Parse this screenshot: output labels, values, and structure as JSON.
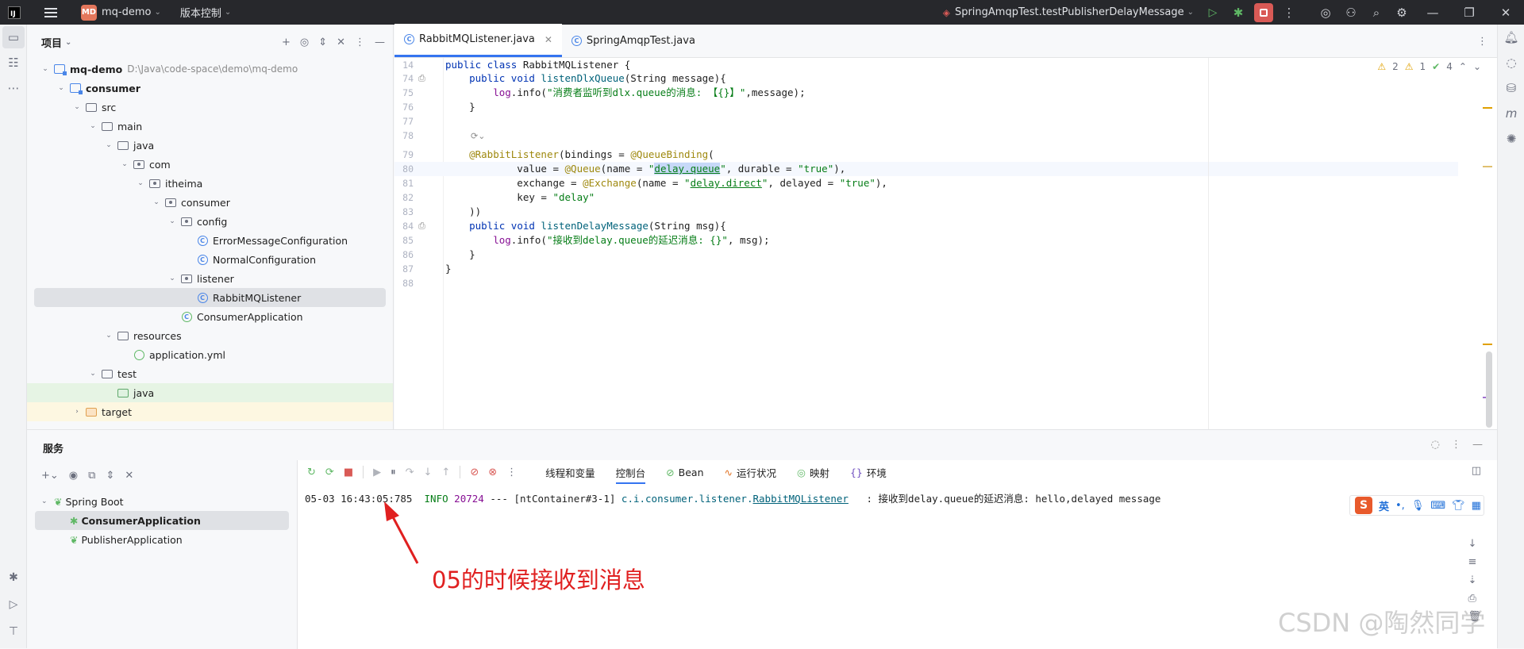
{
  "titlebar": {
    "project_badge": "MD",
    "project_name": "mq-demo",
    "vcs_menu": "版本控制",
    "run_config": "SpringAmqpTest.testPublisherDelayMessage"
  },
  "project_panel": {
    "title": "项目",
    "tree": [
      {
        "label": "mq-demo",
        "path": "D:\\Java\\code-space\\demo\\mq-demo",
        "depth": 0,
        "kind": "module",
        "expanded": true,
        "bold": true
      },
      {
        "label": "consumer",
        "depth": 1,
        "kind": "module",
        "expanded": true,
        "bold": true
      },
      {
        "label": "src",
        "depth": 2,
        "kind": "folder",
        "expanded": true
      },
      {
        "label": "main",
        "depth": 3,
        "kind": "folder",
        "expanded": true
      },
      {
        "label": "java",
        "depth": 4,
        "kind": "folder",
        "expanded": true
      },
      {
        "label": "com",
        "depth": 5,
        "kind": "package",
        "expanded": true
      },
      {
        "label": "itheima",
        "depth": 6,
        "kind": "package",
        "expanded": true
      },
      {
        "label": "consumer",
        "depth": 7,
        "kind": "package",
        "expanded": true
      },
      {
        "label": "config",
        "depth": 8,
        "kind": "package",
        "expanded": true
      },
      {
        "label": "ErrorMessageConfiguration",
        "depth": 9,
        "kind": "class"
      },
      {
        "label": "NormalConfiguration",
        "depth": 9,
        "kind": "class"
      },
      {
        "label": "listener",
        "depth": 8,
        "kind": "package",
        "expanded": true
      },
      {
        "label": "RabbitMQListener",
        "depth": 9,
        "kind": "class",
        "selected": true
      },
      {
        "label": "ConsumerApplication",
        "depth": 8,
        "kind": "springclass"
      },
      {
        "label": "resources",
        "depth": 4,
        "kind": "resfolder",
        "expanded": true
      },
      {
        "label": "application.yml",
        "depth": 5,
        "kind": "yml"
      },
      {
        "label": "test",
        "depth": 3,
        "kind": "folder",
        "expanded": true
      },
      {
        "label": "java",
        "depth": 4,
        "kind": "testfolder",
        "highlight": "green"
      },
      {
        "label": "target",
        "depth": 2,
        "kind": "target",
        "expanded": false,
        "highlight": "yellow"
      }
    ]
  },
  "editor": {
    "tabs": [
      {
        "label": "RabbitMQListener.java",
        "active": true,
        "closable": true
      },
      {
        "label": "SpringAmqpTest.java",
        "active": false,
        "closable": false
      }
    ],
    "inspections": {
      "warnings": "2",
      "weak_warnings": "1",
      "ok": "4"
    },
    "lines": [
      {
        "n": "14",
        "tokens": [
          [
            "kw",
            "public class "
          ],
          [
            "",
            "RabbitMQListener {"
          ]
        ]
      },
      {
        "n": "74",
        "gutter": "run",
        "tokens": [
          [
            "",
            "    "
          ],
          [
            "kw",
            "public void "
          ],
          [
            "fn",
            "listenDlxQueue"
          ],
          [
            "",
            "(String message){"
          ]
        ]
      },
      {
        "n": "75",
        "tokens": [
          [
            "",
            "        "
          ],
          [
            "fld",
            "log"
          ],
          [
            "",
            ".info("
          ],
          [
            "str",
            "\"消费者监听到dlx.queue的消息: 【{}】\""
          ],
          [
            "",
            ",message);"
          ]
        ]
      },
      {
        "n": "76",
        "tokens": [
          [
            "",
            "    }"
          ]
        ]
      },
      {
        "n": "77",
        "tokens": []
      },
      {
        "n": "78",
        "tokens": [],
        "inlay": "⟳⌄"
      },
      {
        "n": "79",
        "tokens": [
          [
            "",
            "    "
          ],
          [
            "ann",
            "@RabbitListener"
          ],
          [
            "",
            "(bindings = "
          ],
          [
            "ann",
            "@QueueBinding"
          ],
          [
            "",
            "("
          ]
        ]
      },
      {
        "n": "80",
        "current": true,
        "tokens": [
          [
            "",
            "            value = "
          ],
          [
            "ann",
            "@Queue"
          ],
          [
            "",
            "(name = "
          ],
          [
            "str",
            "\""
          ],
          [
            "str hl link",
            "delay.queue"
          ],
          [
            "str",
            "\""
          ],
          [
            "",
            ", durable = "
          ],
          [
            "str",
            "\"true\""
          ],
          [
            "",
            "),"
          ]
        ]
      },
      {
        "n": "81",
        "tokens": [
          [
            "",
            "            exchange = "
          ],
          [
            "ann",
            "@Exchange"
          ],
          [
            "",
            "(name = "
          ],
          [
            "str",
            "\""
          ],
          [
            "str link",
            "delay.direct"
          ],
          [
            "str",
            "\""
          ],
          [
            "",
            ", delayed = "
          ],
          [
            "str",
            "\"true\""
          ],
          [
            "",
            "),"
          ]
        ]
      },
      {
        "n": "82",
        "tokens": [
          [
            "",
            "            key = "
          ],
          [
            "str",
            "\"delay\""
          ]
        ]
      },
      {
        "n": "83",
        "tokens": [
          [
            "",
            "    ))"
          ]
        ]
      },
      {
        "n": "84",
        "gutter": "run",
        "tokens": [
          [
            "",
            "    "
          ],
          [
            "kw",
            "public void "
          ],
          [
            "fn",
            "listenDelayMessage"
          ],
          [
            "",
            "(String msg){"
          ]
        ]
      },
      {
        "n": "85",
        "tokens": [
          [
            "",
            "        "
          ],
          [
            "fld",
            "log"
          ],
          [
            "",
            ".info("
          ],
          [
            "str",
            "\"接收到delay.queue的延迟消息: {}\""
          ],
          [
            "",
            ", msg);"
          ]
        ]
      },
      {
        "n": "86",
        "tokens": [
          [
            "",
            "    }"
          ]
        ]
      },
      {
        "n": "87",
        "tokens": [
          [
            "",
            "}"
          ]
        ]
      },
      {
        "n": "88",
        "tokens": []
      }
    ]
  },
  "services": {
    "title": "服务",
    "tree": [
      {
        "label": "Spring Boot",
        "depth": 0,
        "expanded": true
      },
      {
        "label": "ConsumerApplication",
        "depth": 1,
        "selected": true,
        "bold": true
      },
      {
        "label": "PublisherApplication",
        "depth": 1
      }
    ],
    "console_tabs": [
      {
        "label": "线程和变量",
        "active": false
      },
      {
        "label": "控制台",
        "active": true
      },
      {
        "label": "Bean",
        "active": false
      },
      {
        "label": "运行状况",
        "active": false
      },
      {
        "label": "映射",
        "active": false
      },
      {
        "label": "环境",
        "active": false
      }
    ],
    "log": {
      "timestamp": "05-03 16:43:05:785",
      "level": "INFO",
      "pid": "20724",
      "sep": "---",
      "thread": "[ntContainer#3-1]",
      "logger_prefix": "c.i.consumer.listener.",
      "logger_class": "RabbitMQListener",
      "message": ": 接收到delay.queue的延迟消息: hello,delayed message"
    }
  },
  "annotation": "05的时候接收到消息",
  "ime": {
    "logo": "S",
    "lang": "英"
  },
  "watermark": "CSDN @陶然同学",
  "colors": {
    "accent": "#3574f0",
    "annotation": "#e02020",
    "stop": "#d95a56"
  }
}
